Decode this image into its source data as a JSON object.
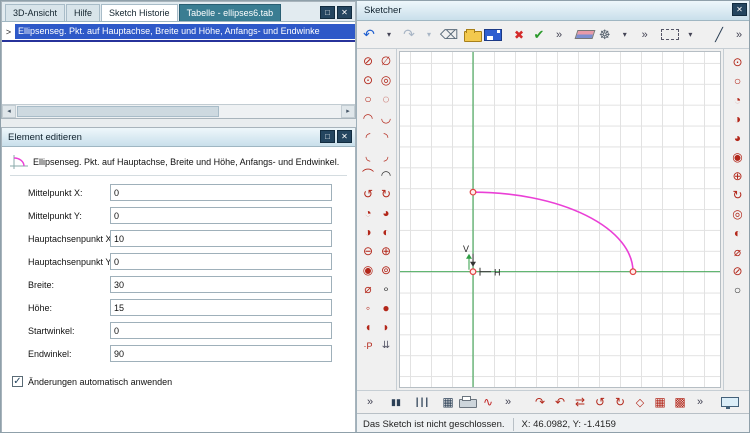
{
  "colors": {
    "selection": "#2e59c8",
    "insert_line": "#27339b",
    "tab_teal": "#3a7d92",
    "axis": "#2f9e44",
    "arc": "#ea3fd6",
    "marker": "#e04545"
  },
  "history_panel": {
    "tabs": [
      {
        "label": "3D-Ansicht"
      },
      {
        "label": "Hilfe"
      },
      {
        "label": "Sketch Historie"
      },
      {
        "label": "Tabelle - ellipses6.tab"
      }
    ],
    "window_buttons": [
      {
        "name": "float-panel-icon",
        "glyph": "□"
      },
      {
        "name": "close-panel-icon",
        "glyph": "✕"
      }
    ],
    "caret": ">",
    "selected_item": "Ellipsenseg. Pkt. auf Hauptachse, Breite und Höhe, Anfangs- und Endwinke",
    "scrollbar": {
      "left_arrow": "◂",
      "right_arrow": "▸"
    }
  },
  "editor_panel": {
    "title": "Element editieren",
    "window_buttons": [
      {
        "name": "float-editor-icon",
        "glyph": "□"
      },
      {
        "name": "close-editor-icon",
        "glyph": "✕"
      }
    ],
    "description": "Ellipsenseg. Pkt. auf Hauptachse, Breite und Höhe, Anfangs- und Endwinkel.",
    "fields": [
      {
        "label": "Mittelpunkt X:",
        "value": "0"
      },
      {
        "label": "Mittelpunkt Y:",
        "value": "0"
      },
      {
        "label": "Hauptachsenpunkt X:",
        "value": "10"
      },
      {
        "label": "Hauptachsenpunkt Y:",
        "value": "0"
      },
      {
        "label": "Breite:",
        "value": "30"
      },
      {
        "label": "Höhe:",
        "value": "15"
      },
      {
        "label": "Startwinkel:",
        "value": "0"
      },
      {
        "label": "Endwinkel:",
        "value": "90"
      }
    ],
    "auto_apply": {
      "label": "Änderungen automatisch anwenden",
      "checked": true,
      "check_glyph": "✓"
    }
  },
  "sketcher": {
    "title": "Sketcher",
    "window_buttons": [
      {
        "name": "close-sketcher-icon",
        "glyph": "✕"
      }
    ],
    "top_toolbar": [
      {
        "name": "undo-icon",
        "glyph": "↶",
        "color": "#1f5fd0",
        "size": 14
      },
      {
        "name": "undo-dropdown-icon",
        "glyph": "▾",
        "color": "#445",
        "size": 8
      },
      {
        "name": "redo-icon",
        "glyph": "↷",
        "color": "#a9b6c6",
        "size": 14
      },
      {
        "name": "redo-dropdown-icon",
        "glyph": "▾",
        "color": "#a9b6c6",
        "size": 8
      },
      {
        "name": "backspace-delete-icon",
        "glyph": "⌫",
        "color": "#5a6b7a",
        "size": 13
      },
      {
        "gap": 6
      },
      {
        "name": "open-file-icon",
        "cls": "icon-folder"
      },
      {
        "name": "save-icon",
        "cls": "icon-floppy"
      },
      {
        "gap": 8
      },
      {
        "name": "cancel-icon",
        "glyph": "✖",
        "color": "#d42a2a",
        "size": 12
      },
      {
        "name": "apply-icon",
        "glyph": "✔",
        "color": "#2a9a2a",
        "size": 13
      },
      {
        "name": "more-tools-icon",
        "glyph": "»",
        "color": "#445",
        "size": 11
      },
      {
        "gap": 8
      },
      {
        "name": "eraser-icon",
        "cls": "icon-eraser"
      },
      {
        "name": "settings-gear-icon",
        "glyph": "☸",
        "color": "#55606c",
        "size": 13
      },
      {
        "name": "gear-dropdown-icon",
        "glyph": "▾",
        "color": "#445",
        "size": 8
      },
      {
        "name": "more-tools-2-icon",
        "glyph": "»",
        "color": "#445",
        "size": 11
      },
      {
        "gap": 8
      },
      {
        "name": "selection-rect-icon",
        "cls": "icon-dashed-rect"
      },
      {
        "name": "selection-dropdown-icon",
        "glyph": "▾",
        "color": "#445",
        "size": 8
      },
      {
        "gap": 12
      },
      {
        "name": "line-tool-icon",
        "glyph": "╱",
        "color": "#2b3f55",
        "size": 13
      },
      {
        "name": "more-tools-3-icon",
        "glyph": "»",
        "color": "#445",
        "size": 11
      }
    ],
    "left_toolbar": [
      {
        "name": "ellipse-tool-icon",
        "glyph": "⊘",
        "color": "#b3271a"
      },
      {
        "name": "ellipse-diameter-tool-icon",
        "glyph": "∅",
        "color": "#b3271a"
      },
      {
        "name": "ellipse-center-point-tool-icon",
        "glyph": "⊙",
        "color": "#b3271a"
      },
      {
        "name": "ellipse-concentric-tool-icon",
        "glyph": "◎",
        "color": "#b3271a"
      },
      {
        "name": "ellipse-freeform-tool-icon",
        "glyph": "○",
        "color": "#b3271a"
      },
      {
        "name": "ellipse-construction-tool-icon",
        "glyph": "◌",
        "color": "#b3271a"
      },
      {
        "name": "arc-upper-tool-icon",
        "glyph": "◠",
        "color": "#b3271a"
      },
      {
        "name": "arc-lower-tool-icon",
        "glyph": "◡",
        "color": "#b3271a"
      },
      {
        "name": "arc-quadrant-ul-tool-icon",
        "glyph": "◜",
        "color": "#b3271a"
      },
      {
        "name": "arc-quadrant-ur-tool-icon",
        "glyph": "◝",
        "color": "#b3271a"
      },
      {
        "name": "arc-quadrant-ll-tool-icon",
        "glyph": "◟",
        "color": "#b3271a"
      },
      {
        "name": "arc-quadrant-lr-tool-icon",
        "glyph": "◞",
        "color": "#b3271a"
      },
      {
        "name": "arc-segment-tool-icon",
        "glyph": "⌒",
        "color": "#b3271a"
      },
      {
        "name": "arc-chord-tool-icon",
        "glyph": "◠",
        "color": "#333333"
      },
      {
        "name": "arc-ccw-tool-icon",
        "glyph": "↺",
        "color": "#b3271a"
      },
      {
        "name": "arc-cw-tool-icon",
        "glyph": "↻",
        "color": "#b3271a"
      },
      {
        "name": "arc-start-angle-tool-icon",
        "glyph": "◔",
        "color": "#b3271a"
      },
      {
        "name": "arc-end-angle-tool-icon",
        "glyph": "◕",
        "color": "#b3271a"
      },
      {
        "name": "half-ellipse-left-tool-icon",
        "glyph": "◑",
        "color": "#b3271a"
      },
      {
        "name": "half-ellipse-right-tool-icon",
        "glyph": "◐",
        "color": "#b3271a"
      },
      {
        "name": "ellipse-minus-tool-icon",
        "glyph": "⊖",
        "color": "#b3271a"
      },
      {
        "name": "ellipse-plus-tool-icon",
        "glyph": "⊕",
        "color": "#b3271a"
      },
      {
        "name": "ellipse-focus-tool-icon",
        "glyph": "◉",
        "color": "#b3271a"
      },
      {
        "name": "ellipse-ring-tool-icon",
        "glyph": "⊚",
        "color": "#b3271a"
      },
      {
        "name": "ellipse-axis-tool-icon",
        "glyph": "⌀",
        "color": "#b3271a"
      },
      {
        "name": "ellipse-point-tool-icon",
        "glyph": "∘",
        "color": "#333333"
      },
      {
        "name": "small-circle-tool-icon",
        "glyph": "◦",
        "color": "#b3271a"
      },
      {
        "name": "filled-circle-tool-icon",
        "glyph": "●",
        "color": "#b3271a"
      },
      {
        "name": "left-half-circle-tool-icon",
        "glyph": "◖",
        "color": "#b3271a"
      },
      {
        "name": "right-half-circle-tool-icon",
        "glyph": "◗",
        "color": "#b3271a"
      },
      {
        "name": "point-p-tool-icon",
        "glyph": "·P",
        "color": "#b3271a",
        "size": 9
      },
      {
        "name": "scroll-down-icon",
        "glyph": "⇊",
        "color": "#556",
        "size": 10
      }
    ],
    "right_toolbar": [
      {
        "name": "circle-center-tool-icon",
        "glyph": "⊙",
        "color": "#b3271a"
      },
      {
        "name": "circle-tool-icon",
        "glyph": "○",
        "color": "#b3271a"
      },
      {
        "name": "circle-quarter-tool-icon",
        "glyph": "◔",
        "color": "#b3271a"
      },
      {
        "name": "circle-half-tool-icon",
        "glyph": "◑",
        "color": "#b3271a"
      },
      {
        "name": "circle-three-quarter-tool-icon",
        "glyph": "◕",
        "color": "#b3271a"
      },
      {
        "name": "circle-focus-tool-icon",
        "glyph": "◉",
        "color": "#b3271a"
      },
      {
        "name": "circle-plus-tool-icon",
        "glyph": "⊕",
        "color": "#b3271a"
      },
      {
        "name": "circle-rotate-tool-icon",
        "glyph": "↻",
        "color": "#b3271a"
      },
      {
        "name": "circle-concentric-tool-icon",
        "glyph": "◎",
        "color": "#b3271a"
      },
      {
        "name": "circle-left-half-tool-icon",
        "glyph": "◐",
        "color": "#b3271a"
      },
      {
        "name": "circle-diameter-tool-icon",
        "glyph": "⌀",
        "color": "#b3271a"
      },
      {
        "name": "circle-slash-tool-icon",
        "glyph": "⊘",
        "color": "#b3271a"
      },
      {
        "name": "circle-plain-tool-icon",
        "glyph": "○",
        "color": "#333333"
      }
    ],
    "bottom_toolbar": [
      {
        "name": "more-left-icon",
        "glyph": "»",
        "color": "#445",
        "size": 11
      },
      {
        "gap": 6
      },
      {
        "name": "pause-bars-icon",
        "glyph": "▮▮",
        "color": "#2b3f55",
        "size": 9
      },
      {
        "gap": 6
      },
      {
        "name": "vertical-bars-icon",
        "glyph": "┃┃┃",
        "color": "#2b3f55",
        "size": 8
      },
      {
        "gap": 6
      },
      {
        "name": "grid-toggle-icon",
        "glyph": "▦",
        "color": "#2b3f55",
        "size": 12
      },
      {
        "name": "print-icon",
        "cls": "icon-printer"
      },
      {
        "name": "freehand-curve-icon",
        "glyph": "∿",
        "color": "#c22222",
        "size": 12
      },
      {
        "name": "more-mid-icon",
        "glyph": "»",
        "color": "#445",
        "size": 11
      },
      {
        "gap": 12
      },
      {
        "name": "rotate-cw-tool-icon",
        "glyph": "↷",
        "color": "#b3271a",
        "size": 12
      },
      {
        "name": "rotate-ccw-tool-icon",
        "glyph": "↶",
        "color": "#b3271a",
        "size": 12
      },
      {
        "name": "mirror-tool-icon",
        "glyph": "⇄",
        "color": "#b3271a",
        "size": 12
      },
      {
        "name": "spin-ccw-tool-icon",
        "glyph": "↺",
        "color": "#b3271a",
        "size": 12
      },
      {
        "name": "spin-cw-tool-icon",
        "glyph": "↻",
        "color": "#b3271a",
        "size": 12
      },
      {
        "name": "diamond-tool-icon",
        "glyph": "◇",
        "color": "#b3271a",
        "size": 11
      },
      {
        "name": "array-grid-icon",
        "glyph": "▦",
        "color": "#b3271a",
        "size": 12
      },
      {
        "name": "hatch-grid-icon",
        "glyph": "▩",
        "color": "#b3271a",
        "size": 12
      },
      {
        "name": "more-right-icon",
        "glyph": "»",
        "color": "#445",
        "size": 11
      },
      {
        "gap": 10
      },
      {
        "name": "monitor-icon",
        "cls": "icon-monitor"
      }
    ],
    "canvas": {
      "v_label": "V",
      "h_label": "H"
    },
    "status": {
      "message": "Das Sketch ist nicht geschlossen.",
      "coords": "X: 46.0982, Y: -1.4159"
    }
  }
}
